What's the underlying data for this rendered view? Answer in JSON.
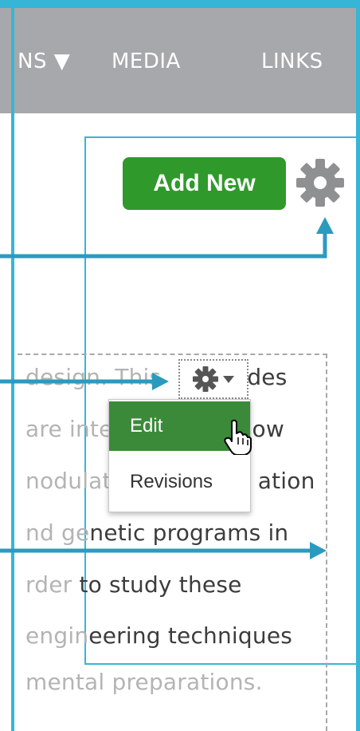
{
  "nav": {
    "items": [
      "NS ▼",
      "MEDIA",
      "LINKS"
    ]
  },
  "toolbar": {
    "add_new_label": "Add New",
    "settings_icon": "gear-icon"
  },
  "content": {
    "lines": [
      {
        "faded": "design. This",
        "dark": "",
        "after": "des"
      },
      {
        "faded": "are inte",
        "dark": "",
        "after": "ow"
      },
      {
        "faded": "nodulat",
        "dark": "",
        "after": "ation"
      },
      {
        "faded": "nd ge",
        "dark": "netic programs in",
        "after": ""
      },
      {
        "faded": "rder ",
        "dark": "to study these",
        "after": ""
      },
      {
        "faded": "engin",
        "dark": "eering techniques",
        "after": ""
      },
      {
        "faded": "mental preparations.",
        "dark": "",
        "after": ""
      }
    ]
  },
  "gear_menu": {
    "items": [
      "Edit",
      "Revisions"
    ],
    "highlighted": "Edit"
  },
  "colors": {
    "accent": "#36b6d6",
    "button_green": "#2f9a2b",
    "menu_highlight": "#3b8a3a",
    "nav_bg": "#a7a8ab"
  }
}
